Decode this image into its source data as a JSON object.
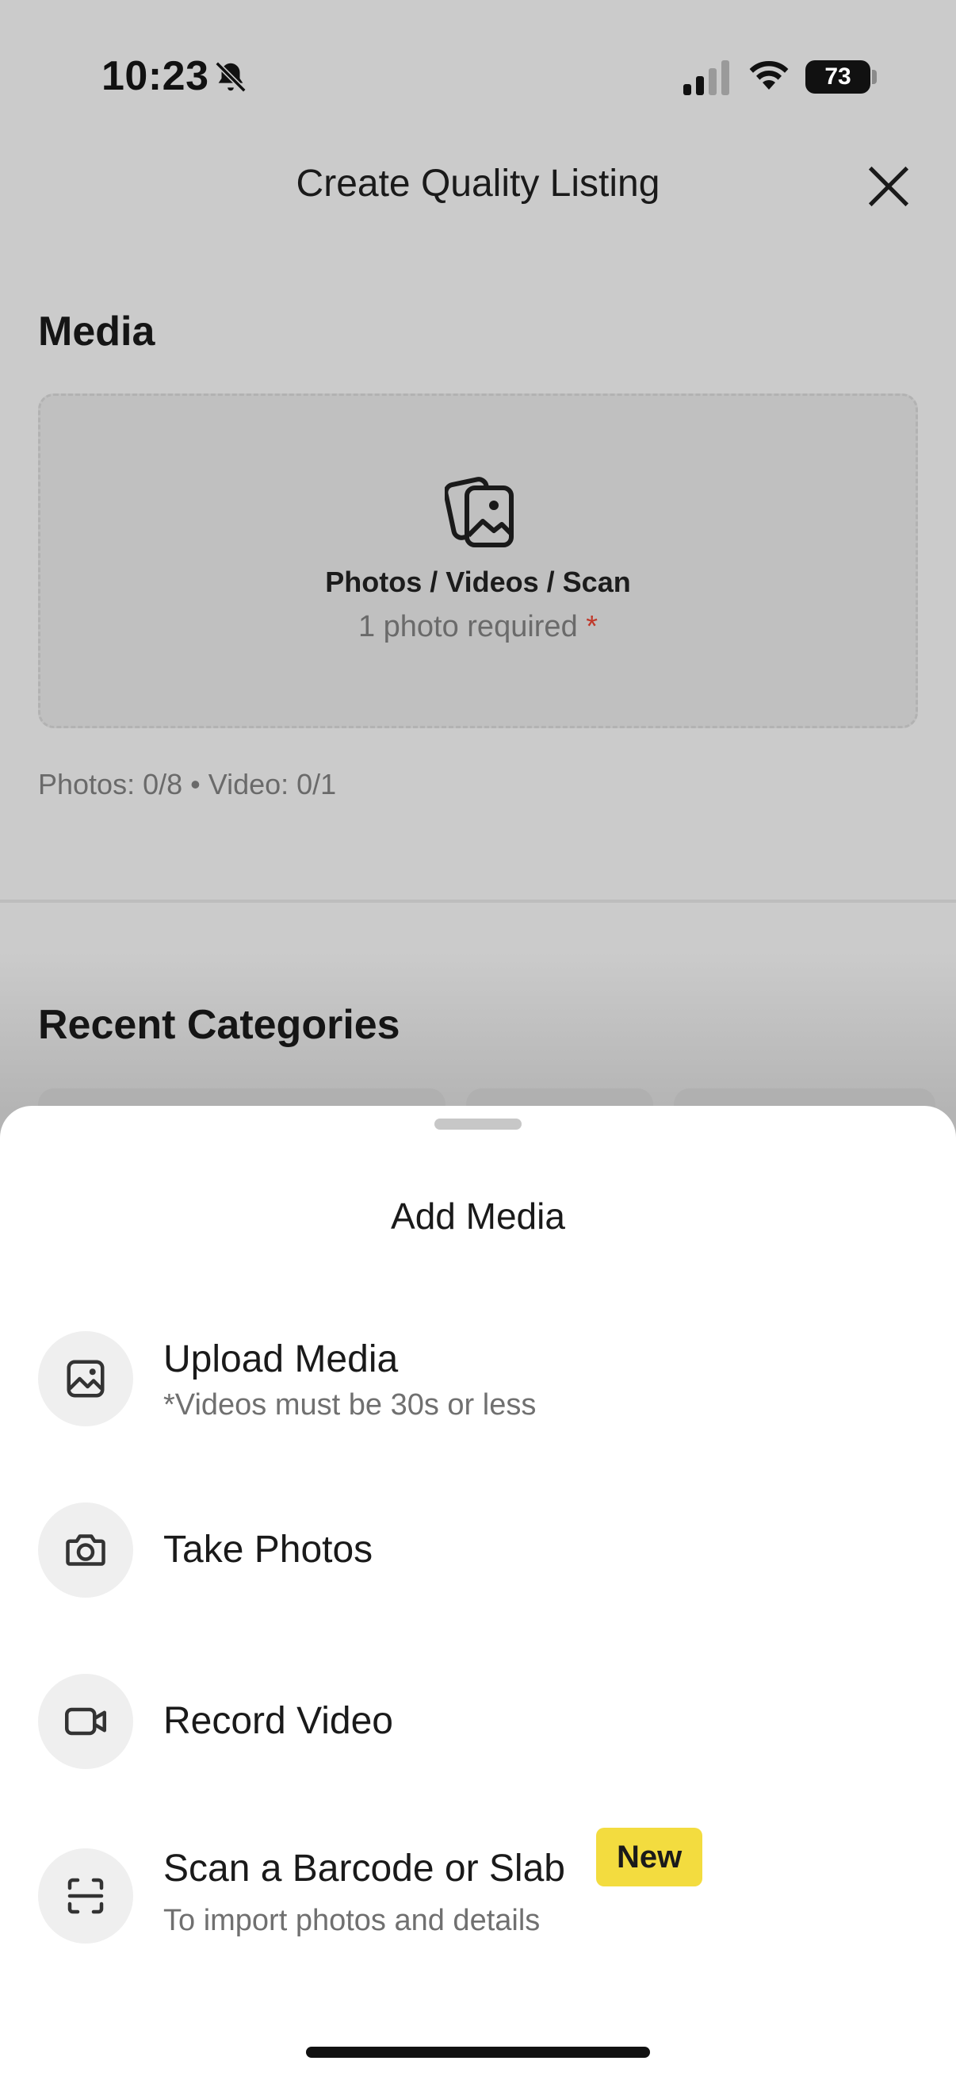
{
  "status_bar": {
    "time": "10:23",
    "battery_level": "73",
    "icons": [
      "bell-slash-icon",
      "cellular-signal-icon",
      "wifi-icon",
      "battery-icon"
    ]
  },
  "nav": {
    "title": "Create Quality Listing",
    "close_icon": "close-icon"
  },
  "media": {
    "section_title": "Media",
    "dropzone_label": "Photos / Videos / Scan",
    "required_text": "1 photo required",
    "required_marker": "*",
    "counts": "Photos: 0/8 • Video: 0/1"
  },
  "recent_categories": {
    "section_title": "Recent Categories"
  },
  "sheet": {
    "title": "Add Media",
    "options": [
      {
        "label": "Upload Media",
        "sub": "*Videos must be 30s or less",
        "icon": "image-icon"
      },
      {
        "label": "Take Photos",
        "sub": "",
        "icon": "camera-icon"
      },
      {
        "label": "Record Video",
        "sub": "",
        "icon": "video-camera-icon"
      },
      {
        "label": "Scan a Barcode or Slab",
        "sub": "To import photos and details",
        "icon": "scan-icon",
        "badge": "New"
      }
    ]
  },
  "colors": {
    "badge": "#f3dc3f",
    "required_star": "#c0392b",
    "overlay_bg": "#cbcbcb"
  }
}
